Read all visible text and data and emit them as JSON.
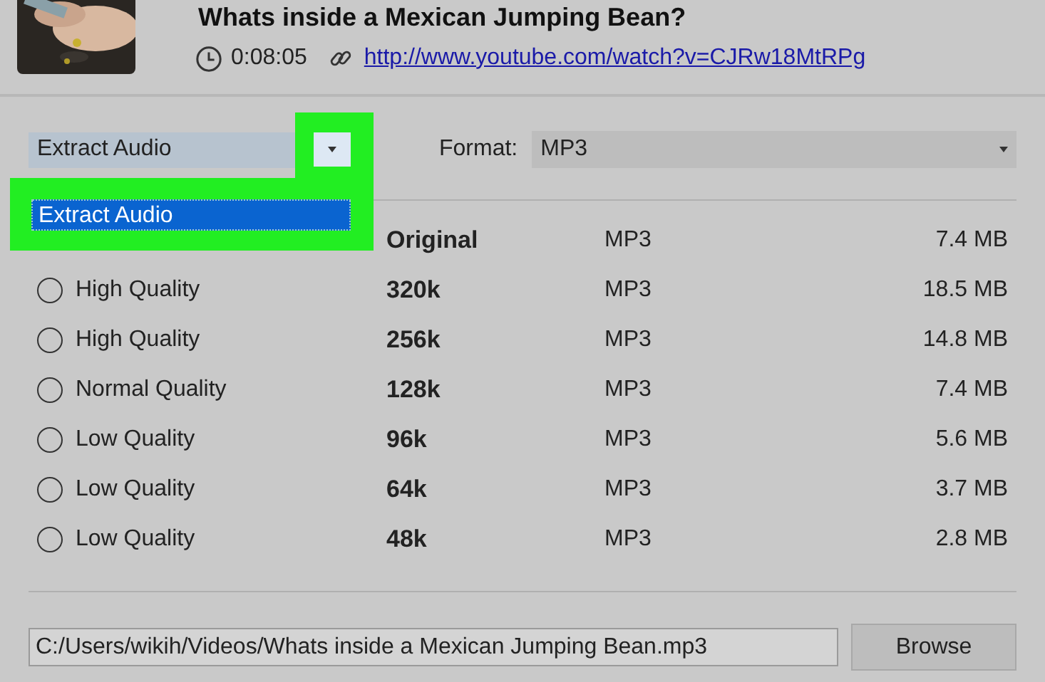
{
  "video": {
    "title": "Whats inside a Mexican Jumping Bean?",
    "duration": "0:08:05",
    "url": "http://www.youtube.com/watch?v=CJRw18MtRPg"
  },
  "mode_dropdown": {
    "value": "Extract Audio",
    "expanded": true,
    "options": [
      {
        "label": "Extract Audio",
        "selected": true
      }
    ]
  },
  "format": {
    "label": "Format:",
    "value": "MP3"
  },
  "qualities": [
    {
      "bitrate": "Original",
      "format": "MP3",
      "size": "7.4 MB"
    },
    {
      "quality": "High Quality",
      "bitrate": "320k",
      "format": "MP3",
      "size": "18.5 MB",
      "selected": false
    },
    {
      "quality": "High Quality",
      "bitrate": "256k",
      "format": "MP3",
      "size": "14.8 MB",
      "selected": false
    },
    {
      "quality": "Normal Quality",
      "bitrate": "128k",
      "format": "MP3",
      "size": "7.4 MB",
      "selected": false
    },
    {
      "quality": "Low Quality",
      "bitrate": "96k",
      "format": "MP3",
      "size": "5.6 MB",
      "selected": false
    },
    {
      "quality": "Low Quality",
      "bitrate": "64k",
      "format": "MP3",
      "size": "3.7 MB",
      "selected": false
    },
    {
      "quality": "Low Quality",
      "bitrate": "48k",
      "format": "MP3",
      "size": "2.8 MB",
      "selected": false
    }
  ],
  "output": {
    "path": "C:/Users/wikih/Videos/Whats inside a Mexican Jumping Bean.mp3",
    "browse_button": "Browse"
  }
}
